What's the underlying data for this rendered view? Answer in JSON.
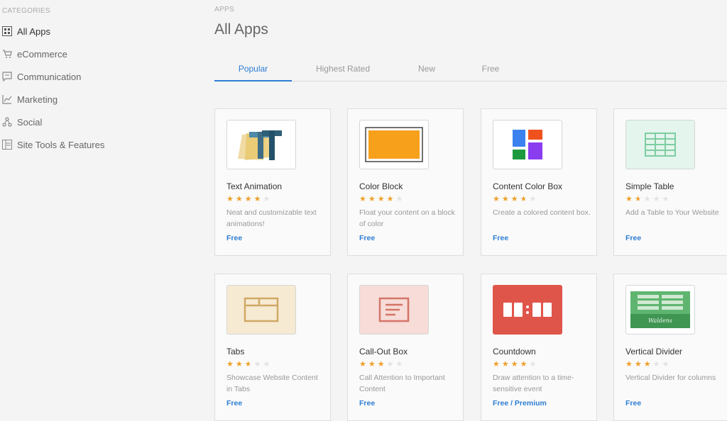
{
  "sidebar": {
    "heading": "CATEGORIES",
    "items": [
      {
        "label": "All Apps",
        "icon": "grid-icon",
        "active": true
      },
      {
        "label": "eCommerce",
        "icon": "cart-icon",
        "active": false
      },
      {
        "label": "Communication",
        "icon": "chat-icon",
        "active": false
      },
      {
        "label": "Marketing",
        "icon": "chart-icon",
        "active": false
      },
      {
        "label": "Social",
        "icon": "share-icon",
        "active": false
      },
      {
        "label": "Site Tools & Features",
        "icon": "tools-icon",
        "active": false
      }
    ]
  },
  "main": {
    "breadcrumb": "APPS",
    "title": "All Apps",
    "tabs": [
      {
        "label": "Popular",
        "active": true
      },
      {
        "label": "Highest Rated",
        "active": false
      },
      {
        "label": "New",
        "active": false
      },
      {
        "label": "Free",
        "active": false
      }
    ]
  },
  "apps": [
    {
      "title": "Text Animation",
      "rating": 4,
      "desc": "Neat and customizable text animations!",
      "price": "Free",
      "icon": "text-animation-icon"
    },
    {
      "title": "Color Block",
      "rating": 4,
      "desc": "Float your content on a block of color",
      "price": "Free",
      "icon": "color-block-icon"
    },
    {
      "title": "Content Color Box",
      "rating": 3.5,
      "desc": "Create a colored content box.",
      "price": "Free",
      "icon": "content-color-box-icon"
    },
    {
      "title": "Simple Table",
      "rating": 1.5,
      "desc": "Add a Table to Your Website",
      "price": "Free",
      "icon": "table-icon"
    },
    {
      "title": "Tabs",
      "rating": 2.5,
      "desc": "Showcase Website Content in Tabs",
      "price": "Free",
      "icon": "tabs-icon"
    },
    {
      "title": "Call-Out Box",
      "rating": 3,
      "desc": "Call Attention to Important Content",
      "price": "Free",
      "icon": "callout-box-icon"
    },
    {
      "title": "Countdown",
      "rating": 4,
      "desc": "Draw attention to a time-sensitive event",
      "price": "Free / Premium",
      "icon": "countdown-icon"
    },
    {
      "title": "Vertical Divider",
      "rating": 3,
      "desc": "Vertical Divider for columns",
      "price": "Free",
      "icon": "vertical-divider-icon",
      "thumb_caption": "Waldens"
    }
  ],
  "colors": {
    "accent": "#2d7dd2",
    "star": "#f0a02a",
    "star_off": "#e3e3e3"
  }
}
